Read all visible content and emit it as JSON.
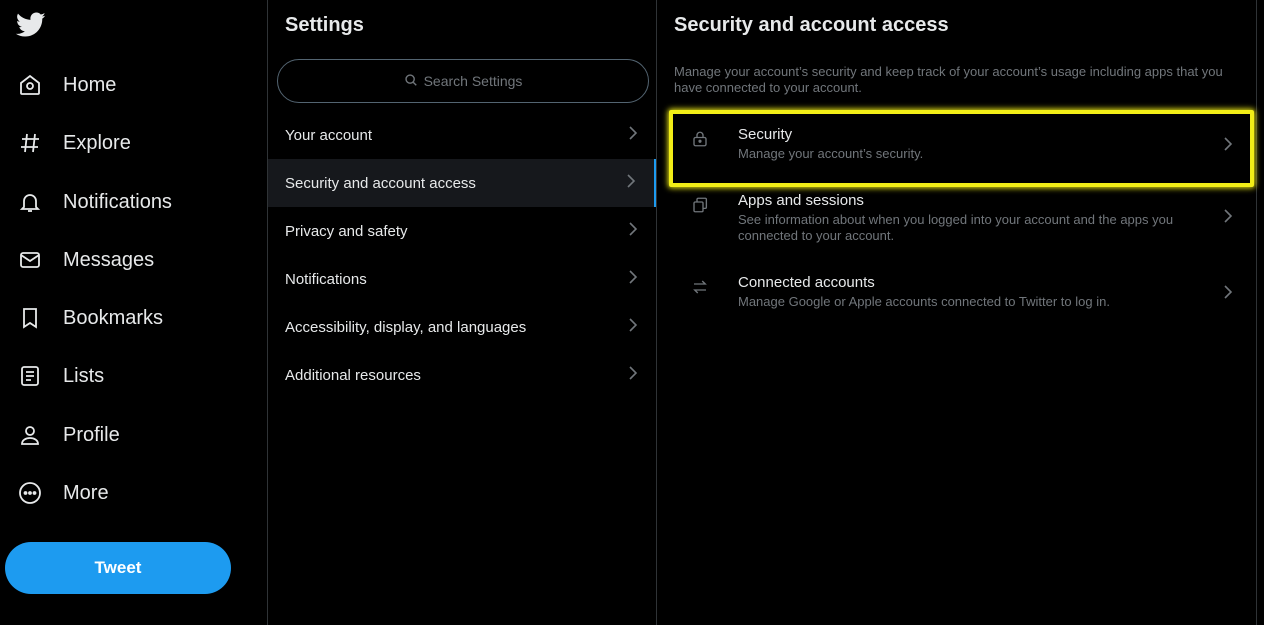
{
  "nav": {
    "items": [
      {
        "label": "Home",
        "icon": "home-icon"
      },
      {
        "label": "Explore",
        "icon": "hashtag-icon"
      },
      {
        "label": "Notifications",
        "icon": "bell-icon"
      },
      {
        "label": "Messages",
        "icon": "envelope-icon"
      },
      {
        "label": "Bookmarks",
        "icon": "bookmark-icon"
      },
      {
        "label": "Lists",
        "icon": "list-icon"
      },
      {
        "label": "Profile",
        "icon": "person-icon"
      },
      {
        "label": "More",
        "icon": "more-circle-icon"
      }
    ],
    "tweet_label": "Tweet"
  },
  "settings": {
    "title": "Settings",
    "search_placeholder": "Search Settings",
    "items": [
      {
        "label": "Your account"
      },
      {
        "label": "Security and account access"
      },
      {
        "label": "Privacy and safety"
      },
      {
        "label": "Notifications"
      },
      {
        "label": "Accessibility, display, and languages"
      },
      {
        "label": "Additional resources"
      }
    ],
    "active_index": 1
  },
  "detail": {
    "title": "Security and account access",
    "description": "Manage your account’s security and keep track of your account’s usage including apps that you have connected to your account.",
    "items": [
      {
        "title": "Security",
        "subtitle": "Manage your account’s security.",
        "icon": "lock-icon"
      },
      {
        "title": "Apps and sessions",
        "subtitle": "See information about when you logged into your account and the apps you connected to your account.",
        "icon": "copy-icon"
      },
      {
        "title": "Connected accounts",
        "subtitle": "Manage Google or Apple accounts connected to Twitter to log in.",
        "icon": "swap-arrows-icon"
      }
    ]
  },
  "colors": {
    "accent": "#1d9bf0",
    "highlight": "#f2ee17",
    "background": "#000000",
    "secondary_text": "#71767b"
  }
}
